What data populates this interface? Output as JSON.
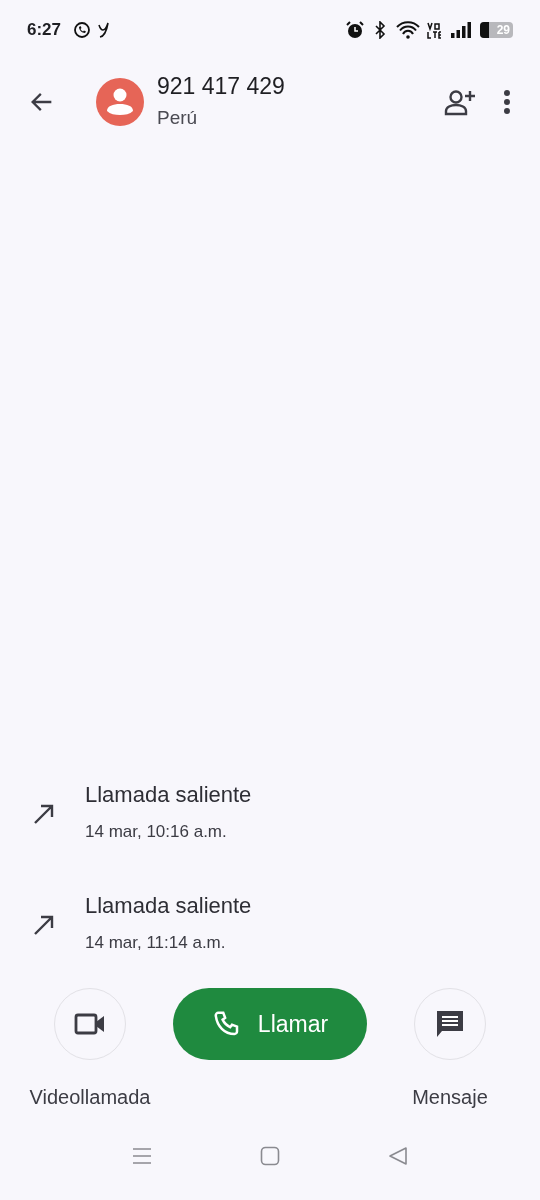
{
  "status_bar": {
    "time": "6:27",
    "battery_text": "29"
  },
  "contact": {
    "number": "921 417 429",
    "country": "Perú"
  },
  "calls": [
    {
      "kind": "outgoing",
      "title": "Llamada saliente",
      "time": "14 mar, 10:16 a.m."
    },
    {
      "kind": "outgoing",
      "title": "Llamada saliente",
      "time": "14 mar, 11:14 a.m."
    }
  ],
  "actions": {
    "video_label": "Videollamada",
    "call_label": "Llamar",
    "message_label": "Mensaje"
  }
}
